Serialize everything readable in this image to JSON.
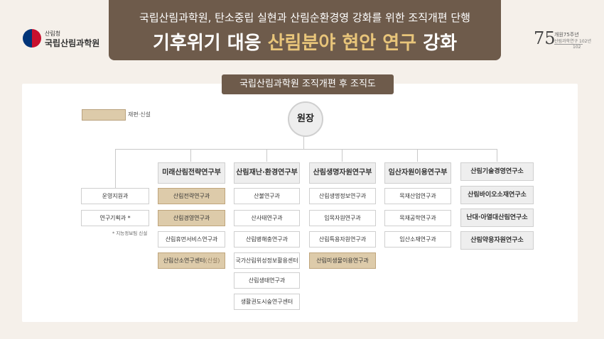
{
  "header": {
    "subtitle": "국립산림과학원, 탄소중립 실현과 산림순환경영 강화를 위한 조직개편 단행",
    "title_part1": "기후위기 대응 ",
    "title_part2": "산림분야 현안 연구",
    "title_part3": " 강화"
  },
  "logo": {
    "small": "산림청",
    "large": "국립산림과학원"
  },
  "anniversary": {
    "number": "75",
    "line1": "개원75주년",
    "line2": "산림과학연구 102년",
    "line3": "102"
  },
  "panel_title": "국립산림과학원 조직개편 후 조직도",
  "legend": {
    "label": "재편·신설"
  },
  "root": "원장",
  "support": {
    "items": [
      "운영지원과",
      "연구기획과 *"
    ],
    "note": "* 지능정보팀 신설"
  },
  "departments": [
    {
      "name": "미래산림전략연구부",
      "units": [
        {
          "label": "산림전략연구과",
          "highlight": true
        },
        {
          "label": "산림경영연구과",
          "highlight": true
        },
        {
          "label": "산림휴먼서비스연구과",
          "highlight": false
        },
        {
          "label": "산림산소연구센터",
          "suffix": "(신설)",
          "highlight": true
        }
      ]
    },
    {
      "name": "산림재난·환경연구부",
      "units": [
        {
          "label": "산불연구과",
          "highlight": false
        },
        {
          "label": "산사태연구과",
          "highlight": false
        },
        {
          "label": "산림병해충연구과",
          "highlight": false
        },
        {
          "label": "국가산림위성정보활용센터",
          "highlight": false
        },
        {
          "label": "산림생태연구과",
          "highlight": false
        },
        {
          "label": "생활권도시숲연구센터",
          "highlight": false
        }
      ]
    },
    {
      "name": "산림생명자원연구부",
      "units": [
        {
          "label": "산림생명정보연구과",
          "highlight": false
        },
        {
          "label": "임목자원연구과",
          "highlight": false
        },
        {
          "label": "산림특용자원연구과",
          "highlight": false
        },
        {
          "label": "산림미생물이용연구과",
          "highlight": true
        }
      ]
    },
    {
      "name": "임산자원이용연구부",
      "units": [
        {
          "label": "목재산업연구과",
          "highlight": false
        },
        {
          "label": "목재공학연구과",
          "highlight": false
        },
        {
          "label": "임산소재연구과",
          "highlight": false
        }
      ]
    }
  ],
  "institutes": [
    "산림기술경영연구소",
    "산림바이오소재연구소",
    "난대·아열대산림연구소",
    "산림약용자원연구소"
  ],
  "colors": {
    "header": "#6e5b4b",
    "highlight": "#ddcbaa",
    "accent": "#e8c57a"
  }
}
